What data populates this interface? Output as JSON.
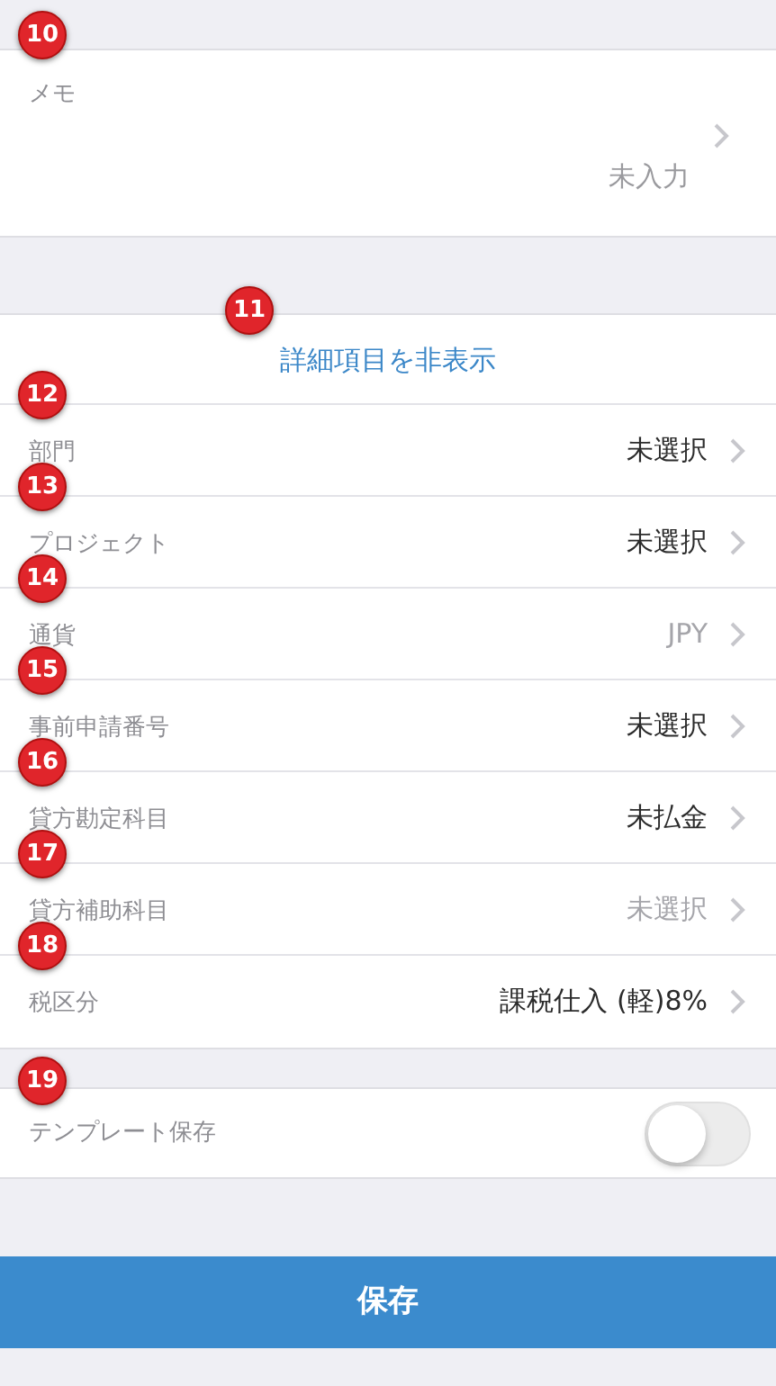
{
  "memo": {
    "marker": "10",
    "label": "メモ",
    "placeholder": "未入力"
  },
  "details_toggle": {
    "marker": "11",
    "label": "詳細項目を非表示"
  },
  "fields": [
    {
      "marker": "12",
      "label": "部門",
      "value": "未選択",
      "disabled": false
    },
    {
      "marker": "13",
      "label": "プロジェクト",
      "value": "未選択",
      "disabled": false
    },
    {
      "marker": "14",
      "label": "通貨",
      "value": "JPY",
      "disabled": true
    },
    {
      "marker": "15",
      "label": "事前申請番号",
      "value": "未選択",
      "disabled": false
    },
    {
      "marker": "16",
      "label": "貸方勘定科目",
      "value": "未払金",
      "disabled": false
    },
    {
      "marker": "17",
      "label": "貸方補助科目",
      "value": "未選択",
      "disabled": true
    },
    {
      "marker": "18",
      "label": "税区分",
      "value": "課税仕入 (軽)8%",
      "disabled": false
    }
  ],
  "template_save": {
    "marker": "19",
    "label": "テンプレート保存",
    "on": false
  },
  "save_button": {
    "label": "保存"
  }
}
